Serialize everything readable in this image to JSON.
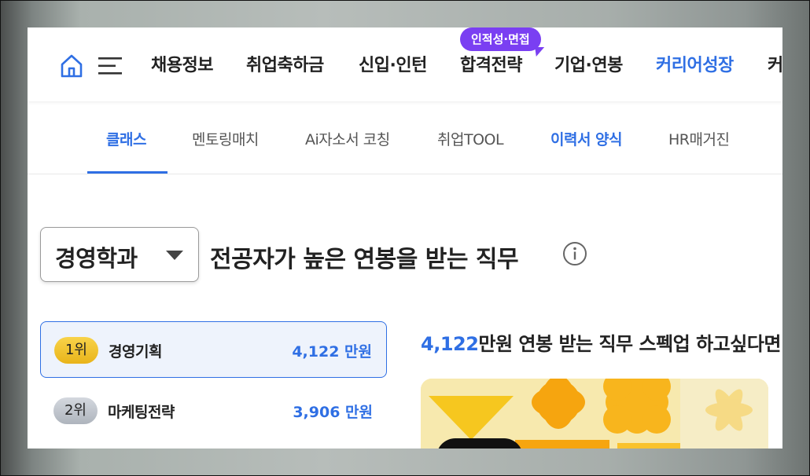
{
  "gnb": {
    "badge": "인적성·면접",
    "items": [
      {
        "label": "채용정보"
      },
      {
        "label": "취업축하금"
      },
      {
        "label": "신입·인턴"
      },
      {
        "label": "합격전략"
      },
      {
        "label": "기업·연봉"
      },
      {
        "label": "커리어성장"
      },
      {
        "label": "커"
      }
    ],
    "active_color": "#2f6fe4",
    "badge_color": "#7a3ff2"
  },
  "subnav": {
    "items": [
      {
        "label": "클래스"
      },
      {
        "label": "멘토링매치"
      },
      {
        "label": "Ai자소서 코칭"
      },
      {
        "label": "취업TOOL"
      },
      {
        "label": "이력서 양식"
      },
      {
        "label": "HR매거진"
      }
    ],
    "selected": "클래스"
  },
  "heading": {
    "department": "경영학과",
    "title": "전공자가 높은 연봉을 받는 직무"
  },
  "ranking": [
    {
      "rank": "1위",
      "job": "경영기획",
      "salary": "4,122 만원",
      "medal": "gold"
    },
    {
      "rank": "2위",
      "job": "마케팅전략",
      "salary": "3,906 만원",
      "medal": "silver"
    }
  ],
  "promo": {
    "amount": "4,122",
    "text": "만원 연봉 받는 직무 스펙업 하고싶다면"
  },
  "icons": [
    "home-icon",
    "hamburger-menu-icon",
    "info-icon",
    "dropdown-caret-icon"
  ]
}
